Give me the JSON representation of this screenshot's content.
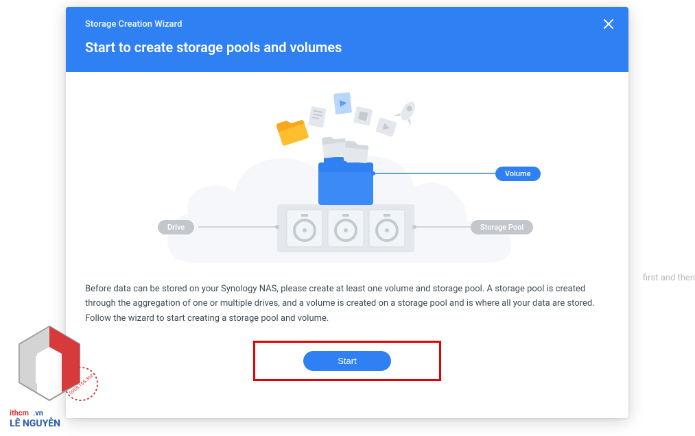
{
  "background": {
    "partial_text": "first and then"
  },
  "dialog": {
    "title": "Storage Creation Wizard",
    "heading": "Start to create storage pools and volumes",
    "labels": {
      "drive": "Drive",
      "volume": "Volume",
      "storage_pool": "Storage Pool"
    },
    "body_text": "Before data can be stored on your Synology NAS, please create at least one volume and storage pool. A storage pool is created through the aggregation of one or multiple drives, and a volume is created on a storage pool and is where all your data are stored. Follow the wizard to start creating a storage pool and volume.",
    "start_label": "Start"
  },
  "watermark": {
    "brand_line1": "ithcm",
    "brand_line2": ".vn",
    "name": "LÊ NGUYỄN",
    "phone": "0908.165.362"
  },
  "colors": {
    "primary": "#2f80f2",
    "pill_gray": "#c3c7cc",
    "text": "#414b55",
    "highlight": "#e60000"
  }
}
